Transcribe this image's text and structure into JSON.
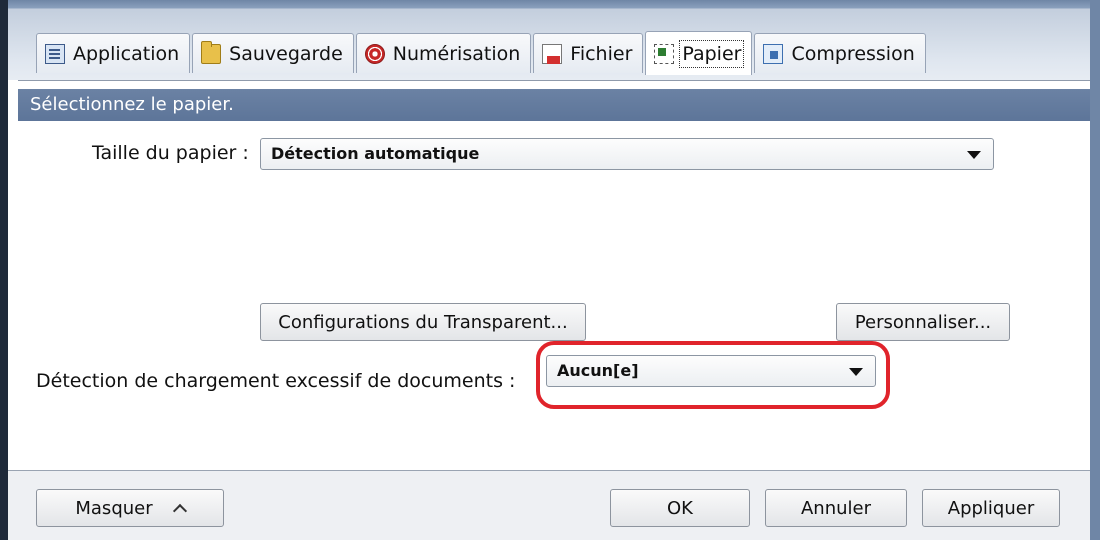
{
  "tabs": [
    {
      "label": "Application",
      "icon": "application-icon"
    },
    {
      "label": "Sauvegarde",
      "icon": "folder-icon"
    },
    {
      "label": "Numérisation",
      "icon": "scan-icon"
    },
    {
      "label": "Fichier",
      "icon": "file-icon"
    },
    {
      "label": "Papier",
      "icon": "paper-icon",
      "active": true
    },
    {
      "label": "Compression",
      "icon": "compression-icon"
    }
  ],
  "header": {
    "title": "Sélectionnez le papier."
  },
  "paper_size": {
    "label": "Taille du papier :",
    "value": "Détection automatique"
  },
  "buttons": {
    "transparent": "Configurations du Transparent...",
    "customize": "Personnaliser..."
  },
  "overload": {
    "label": "Détection de chargement excessif de documents :",
    "value": "Aucun[e]"
  },
  "footer": {
    "hide": "Masquer",
    "ok": "OK",
    "cancel": "Annuler",
    "apply": "Appliquer"
  },
  "colors": {
    "header_bar": "#6b82a4",
    "highlight": "#e0242b"
  }
}
